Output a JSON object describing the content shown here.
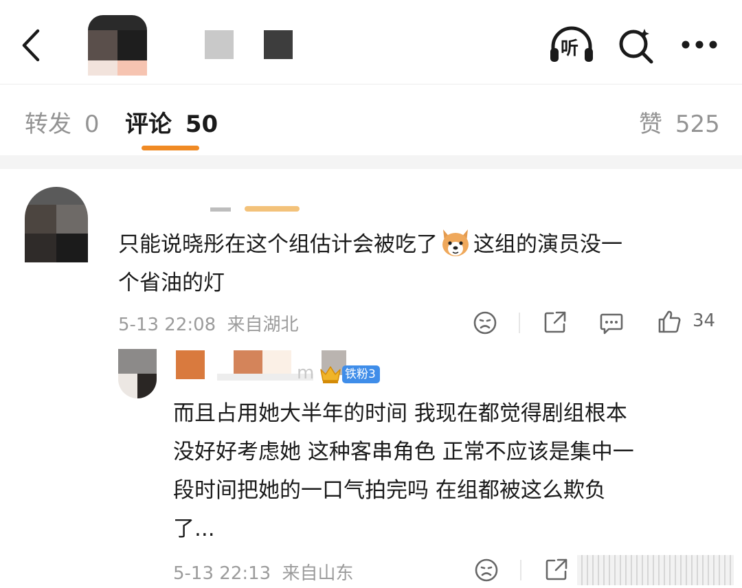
{
  "header": {
    "back_icon": "chevron-left-icon",
    "listen_label": "听",
    "search_icon": "search-icon",
    "more_icon": "more-dots-icon"
  },
  "tabs": [
    {
      "label": "转发",
      "count": "0"
    },
    {
      "label": "评论",
      "count": "50"
    },
    {
      "label": "赞",
      "count": "525"
    }
  ],
  "accent_color": "#f08a24",
  "comments": [
    {
      "username_visible": "",
      "text_line1": "只能说晓彤在这个组估计会被吃了",
      "text_line2a": "这组的演员没一",
      "text_line2b": "个省油的灯",
      "time": "5-13 22:08",
      "location": "来自湖北",
      "like_count": "34"
    }
  ],
  "reply": {
    "username_visible": "m",
    "badge": "铁粉3",
    "lines": [
      "而且占用她大半年的时间 我现在都觉得剧组根本",
      "没好好考虑她 这种客串角色 正常不应该是集中一",
      "段时间把她的一口气拍完吗 在组都被这么欺负",
      "了..."
    ],
    "time": "5-13 22:13",
    "location": "来自山东"
  }
}
